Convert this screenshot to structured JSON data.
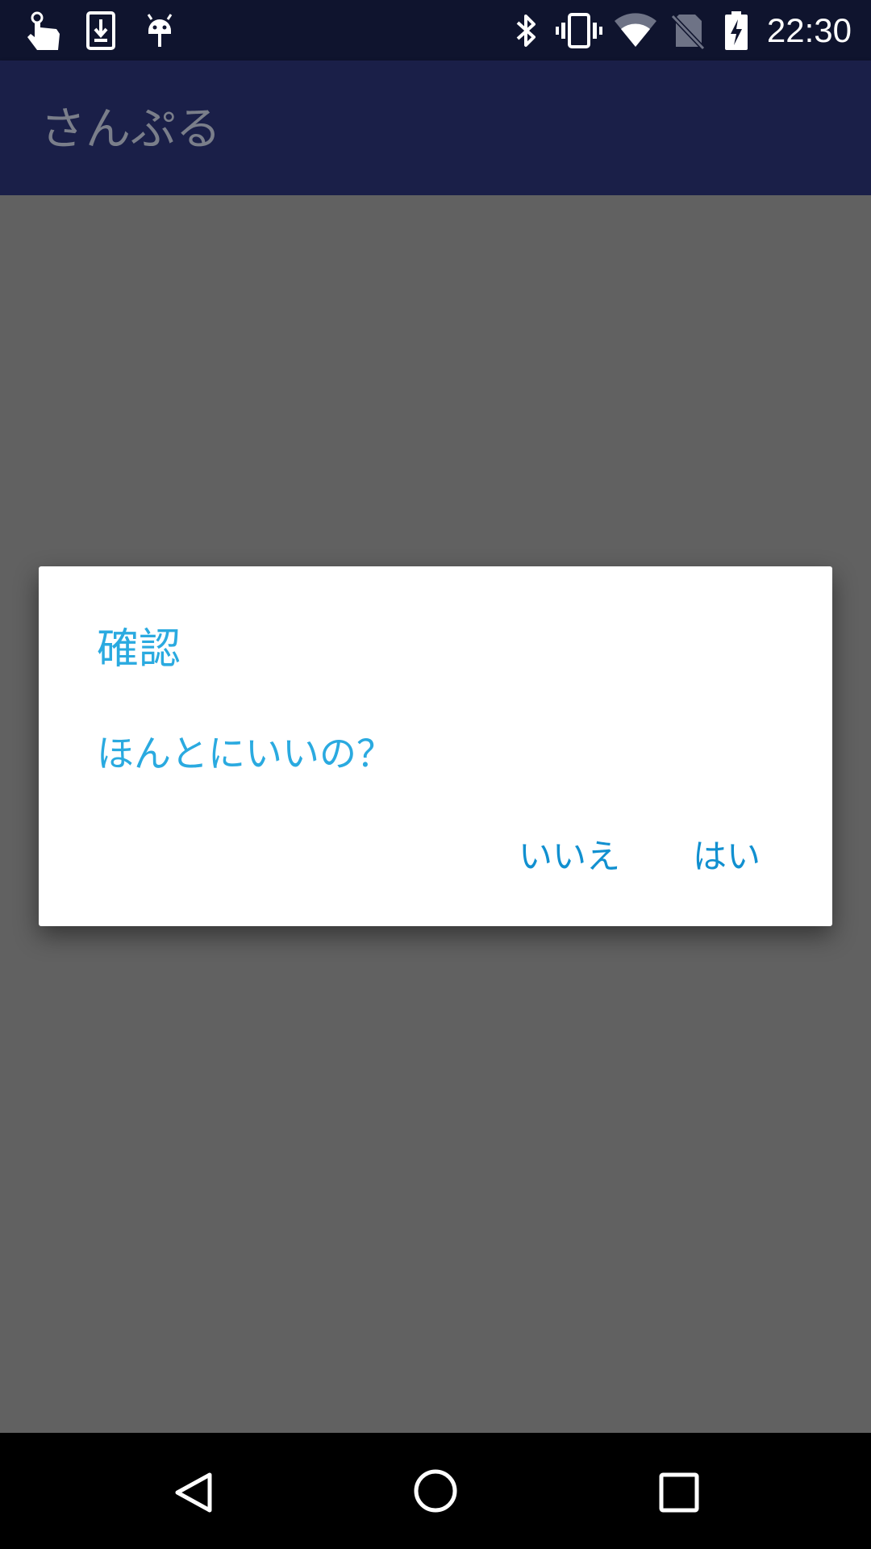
{
  "status_bar": {
    "time": "22:30",
    "left_icons": [
      "touch-icon",
      "download-icon",
      "android-debug-icon"
    ],
    "right_icons": [
      "bluetooth-icon",
      "vibrate-icon",
      "wifi-icon",
      "no-sim-icon",
      "battery-charging-icon"
    ]
  },
  "app_bar": {
    "title": "さんぷる"
  },
  "dialog": {
    "title": "確認",
    "message": "ほんとにいいの？",
    "negative_label": "いいえ",
    "positive_label": "はい"
  },
  "nav_bar": {
    "icons": [
      "back-icon",
      "home-icon",
      "recents-icon"
    ]
  },
  "colors": {
    "status_bar": "#0f142e",
    "app_bar": "#1a1f48",
    "scrim": "#616161",
    "dialog_text": "#2aaae0",
    "button_text": "#1190d0"
  }
}
